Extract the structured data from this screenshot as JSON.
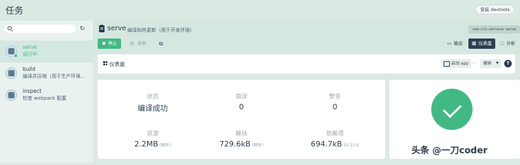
{
  "app": {
    "title": "任务",
    "devtools_label": "安装 devtools"
  },
  "sidebar": {
    "search_placeholder": "",
    "tasks": [
      {
        "name": "serve",
        "desc": "运行中",
        "active": true
      },
      {
        "name": "build",
        "desc": "编译并压缩（用于生产环境...",
        "active": false
      },
      {
        "name": "inspect",
        "desc": "检查 webpack 配置",
        "active": false
      }
    ]
  },
  "task": {
    "name": "serve",
    "desc": "编译和热更新（用于开发环境）",
    "command": "vue-cli-service serve",
    "stop_label": "停止",
    "params_label": "参数",
    "views": {
      "output": "输出",
      "dashboard": "仪表盘",
      "analyze": "分析"
    }
  },
  "dashboard": {
    "title": "仪表盘",
    "start_app_label": "启动 app",
    "analyze_select": "解析",
    "help": "?"
  },
  "stats": {
    "status_label": "状态",
    "status_value": "编译成功",
    "errors_label": "错误",
    "errors_value": "0",
    "warnings_label": "警告",
    "warnings_value": "0",
    "assets_label": "资源",
    "assets_value": "2.2MB",
    "assets_note": "(解析)",
    "modules_label": "模块",
    "modules_value": "729.6kB",
    "modules_note": "(解析)",
    "deps_label": "依赖项",
    "deps_value": "694.7kB",
    "deps_note": "95.21%"
  },
  "watermark": "头条 @一刀coder",
  "colors": {
    "accent": "#42b983",
    "dark": "#2c3e50",
    "muted": "#9aa8b3"
  }
}
